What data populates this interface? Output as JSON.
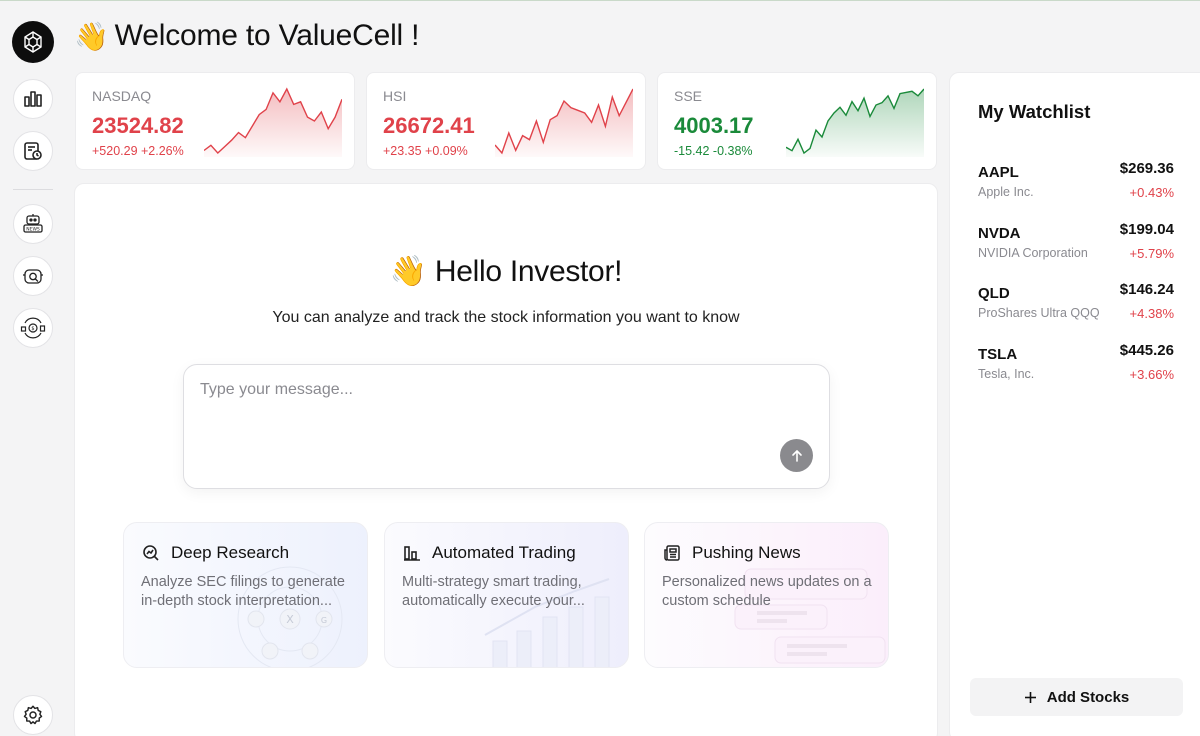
{
  "header": {
    "title_emoji": "👋",
    "title": "Welcome to ValueCell !"
  },
  "sidebar": {
    "items": [
      {
        "name": "market",
        "icon": "bar-chart-icon"
      },
      {
        "name": "history",
        "icon": "clock-document-icon"
      },
      {
        "name": "news-agent",
        "icon": "news-robot-icon"
      },
      {
        "name": "research-agent",
        "icon": "search-robot-icon"
      },
      {
        "name": "trading-agent",
        "icon": "trading-robot-icon"
      }
    ],
    "settings_icon": "gear-icon"
  },
  "indices": [
    {
      "name": "NASDAQ",
      "value": "23524.82",
      "change": "+520.29 +2.26%",
      "trend": "up",
      "color": "#e0424a",
      "series": [
        5,
        9,
        3,
        8,
        13,
        19,
        15,
        24,
        33,
        37,
        50,
        43,
        53,
        41,
        43,
        31,
        28,
        35,
        22,
        31,
        45
      ]
    },
    {
      "name": "HSI",
      "value": "26672.41",
      "change": "+23.35 +0.09%",
      "trend": "up",
      "color": "#e0424a",
      "series": [
        38,
        32,
        47,
        34,
        45,
        42,
        56,
        40,
        57,
        60,
        71,
        66,
        64,
        62,
        55,
        68,
        52,
        74,
        60,
        70,
        80
      ]
    },
    {
      "name": "SSE",
      "value": "4003.17",
      "change": "-15.42 -0.38%",
      "trend": "down",
      "color": "#1a8a3a",
      "series": [
        15,
        12,
        22,
        10,
        14,
        30,
        24,
        38,
        45,
        50,
        43,
        55,
        47,
        58,
        42,
        52,
        54,
        60,
        49,
        62,
        63,
        64,
        60,
        66
      ]
    }
  ],
  "main": {
    "hello_emoji": "👋",
    "hello": "Hello Investor!",
    "subtitle": "You can analyze and track the stock information you want to know",
    "input_placeholder": "Type your message...",
    "send_icon": "arrow-up-icon",
    "features": [
      {
        "title": "Deep Research",
        "icon": "search-chart-icon",
        "desc": "Analyze SEC filings to generate in-depth stock interpretation..."
      },
      {
        "title": "Automated Trading",
        "icon": "bar-chart-icon",
        "desc": "Multi-strategy smart trading, automatically execute your..."
      },
      {
        "title": "Pushing News",
        "icon": "newspaper-icon",
        "desc": "Personalized news updates on a custom schedule"
      }
    ]
  },
  "watchlist": {
    "title": "My Watchlist",
    "stocks": [
      {
        "symbol": "AAPL",
        "name": "Apple Inc.",
        "price": "$269.36",
        "change": "+0.43%"
      },
      {
        "symbol": "NVDA",
        "name": "NVIDIA Corporation",
        "price": "$199.04",
        "change": "+5.79%"
      },
      {
        "symbol": "QLD",
        "name": "ProShares Ultra QQQ",
        "price": "$146.24",
        "change": "+4.38%"
      },
      {
        "symbol": "TSLA",
        "name": "Tesla, Inc.",
        "price": "$445.26",
        "change": "+3.66%"
      }
    ],
    "add_label": "Add Stocks"
  }
}
